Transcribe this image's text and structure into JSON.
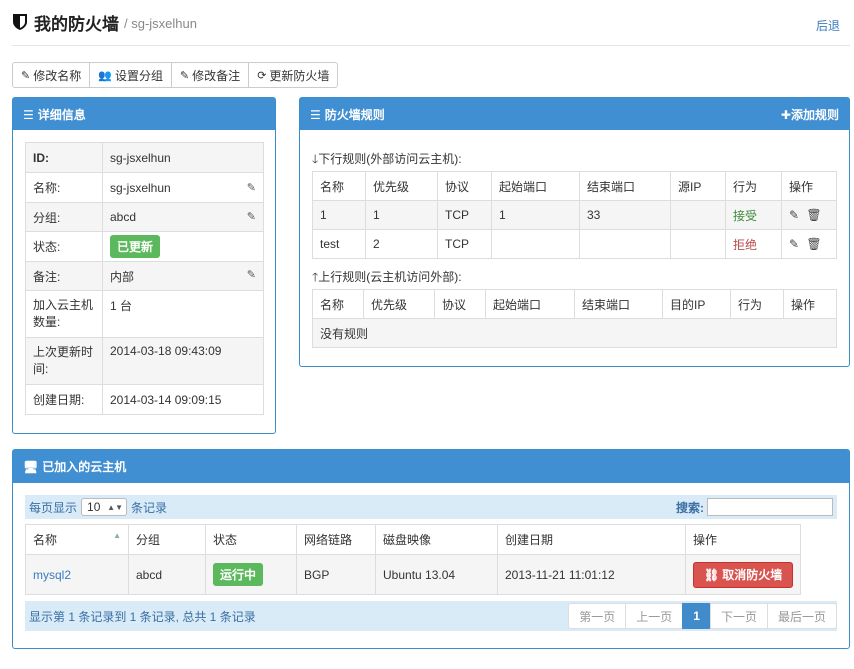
{
  "header": {
    "title": "我的防火墙",
    "subtitle": "/ sg-jsxelhun",
    "back_label": "后退"
  },
  "toolbar": {
    "rename": "修改名称",
    "set_group": "设置分组",
    "edit_note": "修改备注",
    "update_fw": "更新防火墙"
  },
  "detail": {
    "title": "详细信息",
    "rows": [
      {
        "key": "ID:",
        "value": "sg-jsxelhun"
      },
      {
        "key": "名称:",
        "value": "sg-jsxelhun"
      },
      {
        "key": "分组:",
        "value": "abcd"
      },
      {
        "key": "状态:",
        "value": "已更新"
      },
      {
        "key": "备注:",
        "value": "内部"
      },
      {
        "key": "加入云主机数量:",
        "value": "1 台"
      },
      {
        "key": "上次更新时间:",
        "value": "2014-03-18 09:43:09"
      },
      {
        "key": "创建日期:",
        "value": "2014-03-14 09:09:15"
      }
    ]
  },
  "firewall": {
    "title": "防火墙规则",
    "add_rule": "添加规则",
    "inbound_label": "下行规则(外部访问云主机):",
    "inbound_headers": [
      "名称",
      "优先级",
      "协议",
      "起始端口",
      "结束端口",
      "源IP",
      "行为",
      "操作"
    ],
    "inbound_rows": [
      {
        "name": "1",
        "priority": "1",
        "protocol": "TCP",
        "start": "1",
        "end": "33",
        "ip": "",
        "action": "接受"
      },
      {
        "name": "test",
        "priority": "2",
        "protocol": "TCP",
        "start": "",
        "end": "",
        "ip": "",
        "action": "拒绝"
      }
    ],
    "outbound_label": "上行规则(云主机访问外部):",
    "outbound_headers": [
      "名称",
      "优先级",
      "协议",
      "起始端口",
      "结束端口",
      "目的IP",
      "行为",
      "操作"
    ],
    "outbound_empty": "没有规则"
  },
  "hosts": {
    "title": "已加入的云主机",
    "per_page_prefix": "每页显示",
    "per_page_value": "10",
    "per_page_suffix": "条记录",
    "search_label": "搜索:",
    "headers": [
      "名称",
      "分组",
      "状态",
      "网络链路",
      "磁盘映像",
      "创建日期",
      "操作"
    ],
    "rows": [
      {
        "name": "mysql2",
        "group": "abcd",
        "status": "运行中",
        "network": "BGP",
        "image": "Ubuntu 13.04",
        "created": "2013-11-21 11:01:12",
        "action": "取消防火墙"
      }
    ],
    "summary": "显示第 1 条记录到 1 条记录, 总共 1 条记录",
    "pager": {
      "first": "第一页",
      "prev": "上一页",
      "current": "1",
      "next": "下一页",
      "last": "最后一页"
    }
  },
  "colors": {
    "primary": "#3f8fd2",
    "success": "#5cb85c",
    "danger": "#d9534f",
    "link": "#3b7bbf"
  }
}
